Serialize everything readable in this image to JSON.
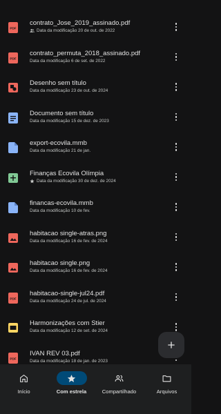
{
  "colors": {
    "background": "#131314",
    "pdf": "#ee675c",
    "drawing": "#ee675c",
    "document": "#8ab4f8",
    "sheet": "#81c995",
    "file": "#8ab4f8",
    "image": "#ee675c",
    "slides": "#fdd663",
    "nav_active": "#004a77"
  },
  "files": [
    {
      "name": "contrato_Jose_2019_assinado.pdf",
      "meta": "Data da modificação 20 de out. de 2022",
      "icon": "pdf-icon",
      "meta_icon": "shared-icon"
    },
    {
      "name": "contrato_permuta_2018_assinado.pdf",
      "meta": "Data da modificação 6 de set. de 2022",
      "icon": "pdf-icon",
      "meta_icon": ""
    },
    {
      "name": "Desenho sem título",
      "meta": "Data da modificação 23 de out. de 2024",
      "icon": "drawing-icon",
      "meta_icon": ""
    },
    {
      "name": "Documento sem título",
      "meta": "Data da modificação 15 de dez. de 2023",
      "icon": "document-icon",
      "meta_icon": ""
    },
    {
      "name": "export-ecovila.mmb",
      "meta": "Data da modificação 21 de jan.",
      "icon": "file-icon",
      "meta_icon": ""
    },
    {
      "name": "Finanças Ecovila Olímpia",
      "meta": "Data da modificação 30 de dez. de 2024",
      "icon": "sheet-icon",
      "meta_icon": "star-icon"
    },
    {
      "name": "financas-ecovila.mmb",
      "meta": "Data da modificação 10 de fev.",
      "icon": "file-icon",
      "meta_icon": ""
    },
    {
      "name": "habitacao single-atras.png",
      "meta": "Data da modificação 16 de fev. de 2024",
      "icon": "image-icon",
      "meta_icon": ""
    },
    {
      "name": "habitacao single.png",
      "meta": "Data da modificação 16 de fev. de 2024",
      "icon": "image-icon",
      "meta_icon": ""
    },
    {
      "name": "habitacao-single-jul24.pdf",
      "meta": "Data da modificação 24 de jul. de 2024",
      "icon": "pdf-icon",
      "meta_icon": ""
    },
    {
      "name": "Harmonizações com Stier",
      "meta": "Data da modificação 12 de set. de 2024",
      "icon": "slides-icon",
      "meta_icon": ""
    },
    {
      "name": "IVAN REV 03.pdf",
      "meta": "Data da modificação 18 de jan. de 2023",
      "icon": "pdf-icon",
      "meta_icon": ""
    }
  ],
  "fab": {
    "icon": "plus-icon"
  },
  "nav": [
    {
      "label": "Início",
      "icon": "home-icon",
      "active": false
    },
    {
      "label": "Com estrela",
      "icon": "star-icon",
      "active": true
    },
    {
      "label": "Compartilhado",
      "icon": "people-icon",
      "active": false
    },
    {
      "label": "Arquivos",
      "icon": "folder-icon",
      "active": false
    }
  ]
}
